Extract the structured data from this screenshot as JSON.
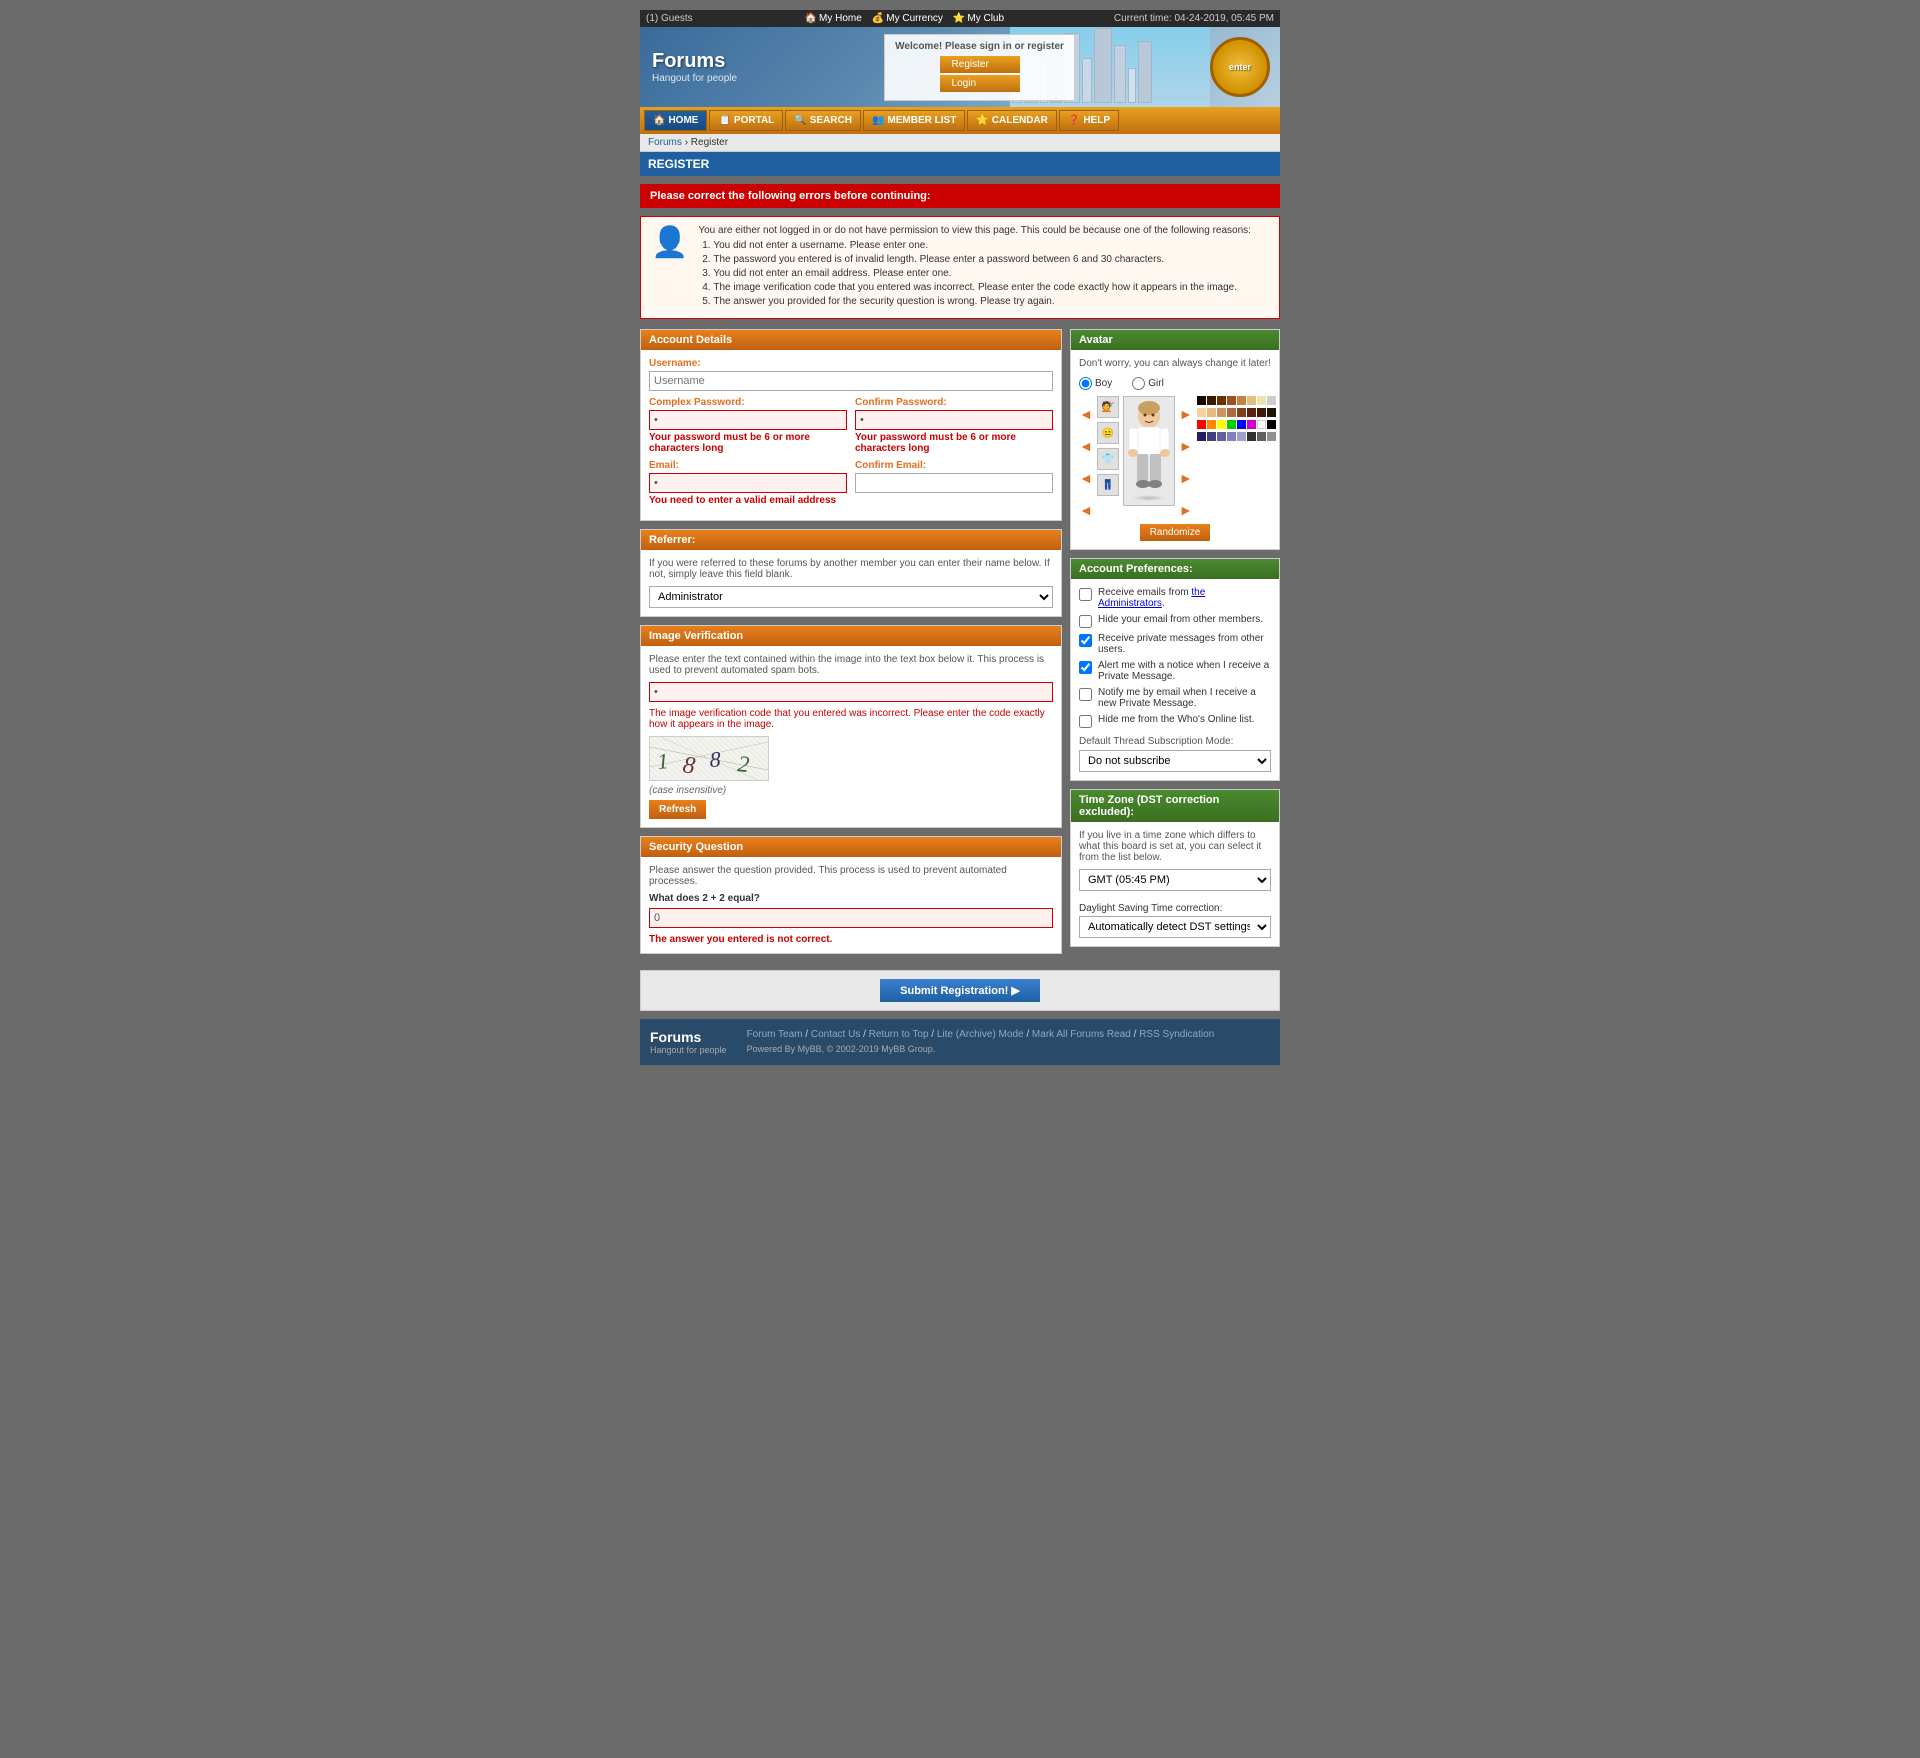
{
  "site": {
    "title": "Forums",
    "subtitle": "Hangout for people"
  },
  "topbar": {
    "guests": "(1) Guests",
    "my_home": "My Home",
    "my_currency": "My Currency",
    "my_club": "My Club",
    "current_time": "Current time: 04-24-2019, 05:45 PM"
  },
  "welcome": {
    "message": "Welcome! Please sign in or register",
    "register_label": "Register",
    "login_label": "Login"
  },
  "nav": {
    "items": [
      {
        "id": "home",
        "label": "HOME",
        "active": true
      },
      {
        "id": "portal",
        "label": "PORTAL",
        "active": false
      },
      {
        "id": "search",
        "label": "SEARCH",
        "active": false
      },
      {
        "id": "memberlist",
        "label": "MEMBER LIST",
        "active": false
      },
      {
        "id": "calendar",
        "label": "CALENDAR",
        "active": false
      },
      {
        "id": "help",
        "label": "HELP",
        "active": false
      }
    ]
  },
  "breadcrumb": {
    "home": "Forums",
    "current": "Register"
  },
  "page_title": "REGISTER",
  "error_banner": "Please correct the following errors before continuing:",
  "error_intro": "You are either not logged in or do not have permission to view this page. This could be because one of the following reasons:",
  "errors": [
    "You did not enter a username. Please enter one.",
    "The password you entered is of invalid length. Please enter a password between 6 and 30 characters.",
    "You did not enter an email address. Please enter one.",
    "The image verification code that you entered was incorrect. Please enter the code exactly how it appears in the image.",
    "The answer you provided for the security question is wrong. Please try again."
  ],
  "account_details": {
    "header": "Account Details",
    "username_label": "Username:",
    "username_placeholder": "Username",
    "password_label": "Complex Password:",
    "password_value": "•",
    "password_error": "Your password must be 6 or more characters long",
    "confirm_password_label": "Confirm Password:",
    "confirm_password_value": "•",
    "confirm_password_error": "Your password must be 6 or more characters long",
    "email_label": "Email:",
    "email_value": "•",
    "email_error": "You need to enter a valid email address",
    "confirm_email_label": "Confirm Email:",
    "confirm_email_value": ""
  },
  "referrer": {
    "header": "Referrer:",
    "description": "If you were referred to these forums by another member you can enter their name below. If not, simply leave this field blank.",
    "default_option": "Administrator"
  },
  "image_verification": {
    "header": "Image Verification",
    "description": "Please enter the text contained within the image into the text box below it. This process is used to prevent automated spam bots.",
    "input_value": "•",
    "error": "The image verification code that you entered was incorrect. Please enter the code exactly how it appears in the image.",
    "captcha_text": "1 8 8 2",
    "case_label": "(case insensitive)",
    "refresh_label": "Refresh"
  },
  "security_question": {
    "header": "Security Question",
    "description": "Please answer the question provided. This process is used to prevent automated processes.",
    "question": "What does 2 + 2 equal?",
    "answer_value": "0",
    "error": "The answer you entered is not correct."
  },
  "avatar": {
    "header": "Avatar",
    "description": "Don't worry, you can always change it later!",
    "gender_boy": "Boy",
    "gender_girl": "Girl",
    "randomize_label": "Randomize"
  },
  "account_preferences": {
    "header": "Account Preferences:",
    "items": [
      {
        "id": "recv_emails",
        "checked": false,
        "label": "Receive emails from the Administrators.",
        "has_link": true,
        "link_text": "the Administrators"
      },
      {
        "id": "hide_email",
        "checked": false,
        "label": "Hide your email from other members."
      },
      {
        "id": "recv_pm",
        "checked": true,
        "label": "Receive private messages from other users."
      },
      {
        "id": "alert_pm",
        "checked": true,
        "label": "Alert me with a notice when I receive a Private Message."
      },
      {
        "id": "notify_pm_email",
        "checked": false,
        "label": "Notify me by email when I receive a new Private Message."
      },
      {
        "id": "hide_online",
        "checked": false,
        "label": "Hide me from the Who's Online list."
      }
    ],
    "subscription_label": "Default Thread Subscription Mode:",
    "subscription_value": "Do not subscribe"
  },
  "timezone": {
    "header": "Time Zone (DST correction excluded):",
    "description": "If you live in a time zone which differs to what this board is set at, you can select it from the list below.",
    "tz_label": "",
    "tz_value": "GMT (05:45 PM)",
    "dst_label": "Daylight Saving Time correction:",
    "dst_value": "Automatically detect DST settings"
  },
  "submit": {
    "label": "Submit Registration!"
  },
  "footer": {
    "title": "Forums",
    "subtitle": "Hangout for people",
    "links": [
      "Forum Team",
      "Contact Us",
      "Return to Top",
      "Lite (Archive) Mode",
      "Mark All Forums Read",
      "RSS Syndication"
    ],
    "powered": "Powered By MyBB, © 2002-2019 MyBB Group."
  },
  "colors": {
    "orange": "#e8801a",
    "dark_orange": "#c06010",
    "blue": "#2060a0",
    "dark_blue": "#1a4a80",
    "green": "#4a8a30",
    "red": "#c00000",
    "error_red": "#cc0000"
  }
}
